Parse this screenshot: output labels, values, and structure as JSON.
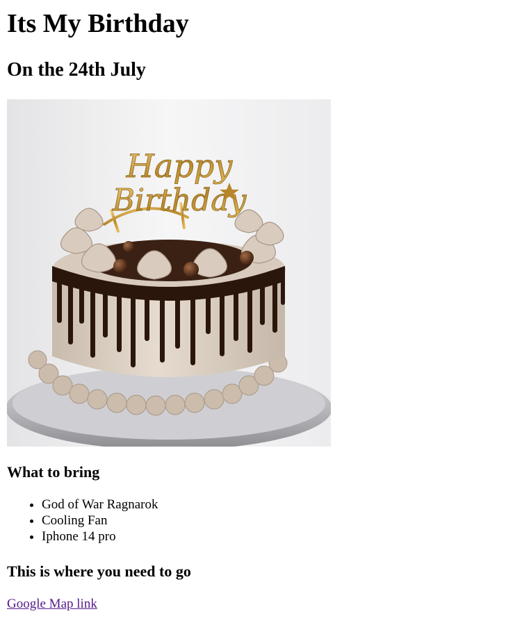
{
  "page": {
    "title": "Its My Birthday",
    "subtitle": "On the 24th July"
  },
  "image": {
    "icon": "birthday-cake-photo",
    "topper_text": "Happy Birthday"
  },
  "bring": {
    "heading": "What to bring",
    "items": [
      "God of War Ragnarok",
      "Cooling Fan",
      "Iphone 14 pro"
    ]
  },
  "location": {
    "heading": "This is where you need to go",
    "link_label": "Google Map link"
  },
  "colors": {
    "text": "#000000",
    "visited_link": "#551a8b"
  }
}
